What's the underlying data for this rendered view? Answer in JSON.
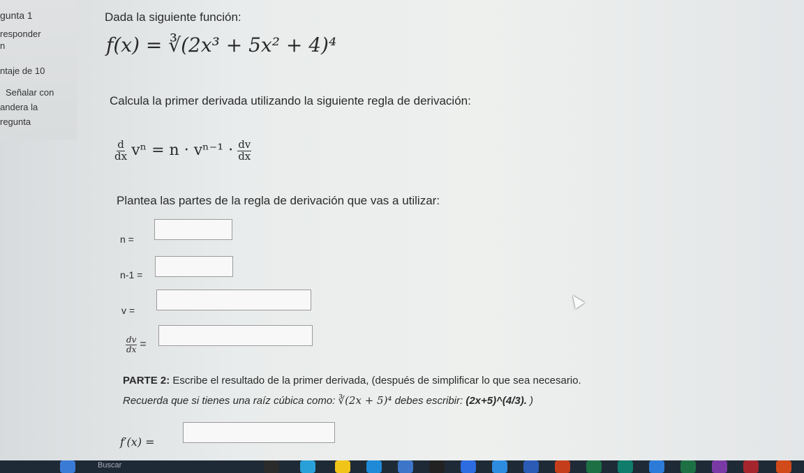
{
  "sidebar": {
    "question": "gunta 1",
    "status": "responder",
    "line3": "n",
    "score": "ntaje de 10",
    "flag1": "Señalar con",
    "flag2": "andera la",
    "flag3": "regunta"
  },
  "question": {
    "intro": "Dada la siguiente función:",
    "function": "f(x) = ∛(2x³ + 5x² + 4)⁴",
    "instruction": "Calcula la primer derivada utilizando la siguiente regla de derivación:",
    "rule_left_num": "d",
    "rule_left_den": "dx",
    "rule_mid": "vⁿ = n · vⁿ⁻¹ ·",
    "rule_right_num": "dv",
    "rule_right_den": "dx",
    "plantea": "Plantea las partes de la regla de derivación que vas a utilizar:",
    "n_label": "n =",
    "n1_label": "n-1 =",
    "v_label": "v =",
    "dvdx_num": "dv",
    "dvdx_den": "dx",
    "dvdx_eq": "=",
    "part2_bold": "PARTE 2:",
    "part2_text": " Escribe el resultado de la primer derivada, (después de simplificar lo que sea necesario.",
    "recuerda": "Recuerda que si tienes una raíz cúbica como: ",
    "recuerda_math": "∛(2x + 5)⁴",
    "debes": " debes escribir: ",
    "debes_example": "(2x+5)^(4/3).",
    "close_paren": " )",
    "fprime_label": "f′(x) ="
  },
  "taskbar": {
    "search": "Buscar"
  }
}
